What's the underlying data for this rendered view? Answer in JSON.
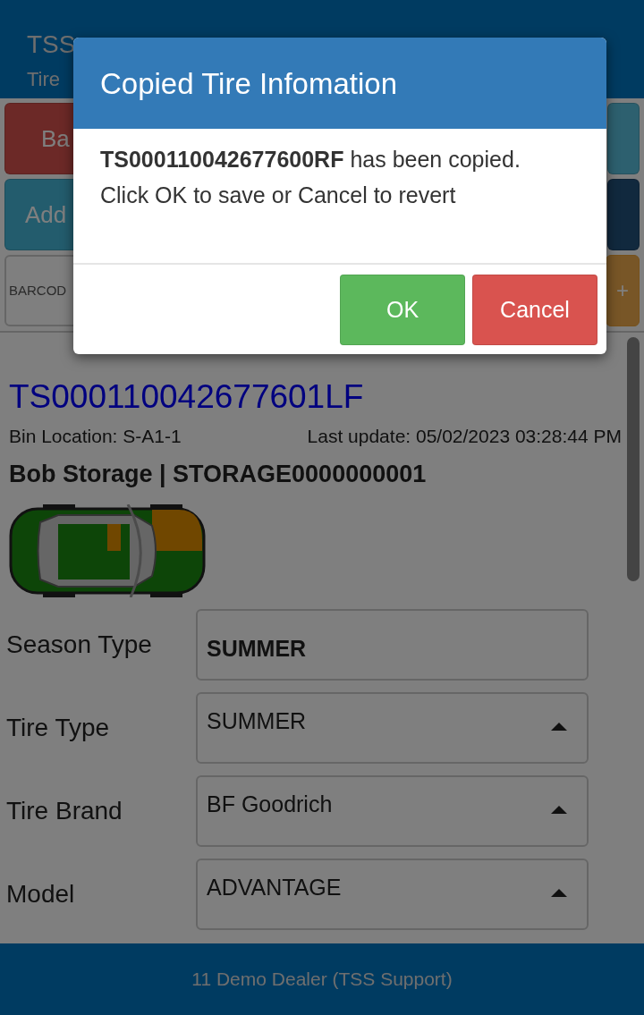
{
  "header": {
    "title": "TSS",
    "subtitle": "Tire"
  },
  "buttons": [
    {
      "label": "Ba",
      "kind": "danger"
    },
    {
      "kind": "info"
    },
    {
      "label": "Add",
      "kind": "teal"
    },
    {
      "kind": "navy"
    }
  ],
  "barcode": {
    "placeholder": "BARCOD"
  },
  "add_button": {
    "label": "+"
  },
  "tire": {
    "id": "TS000110042677601LF",
    "bin_location": "Bin Location: S-A1-1",
    "last_update": "Last update: 05/02/2023 03:28:44 PM",
    "owner": "Bob Storage | STORAGE0000000001"
  },
  "fields": [
    {
      "label": "Season Type",
      "value": "SUMMER",
      "kind": "text"
    },
    {
      "label": "Tire Type",
      "value": "SUMMER",
      "kind": "select"
    },
    {
      "label": "Tire Brand",
      "value": "BF Goodrich",
      "kind": "select"
    },
    {
      "label": "Model",
      "value": "ADVANTAGE",
      "kind": "select"
    }
  ],
  "footer": {
    "text": "11 Demo Dealer (TSS Support)"
  },
  "dialog": {
    "title": "Copied Tire Infomation",
    "message": "**TS000110042677600RF** has been copied. Click OK to save or Cancel to revert",
    "buttons": [
      {
        "label": "OK",
        "kind": "success"
      },
      {
        "label": "Cancel",
        "kind": "danger"
      }
    ]
  }
}
